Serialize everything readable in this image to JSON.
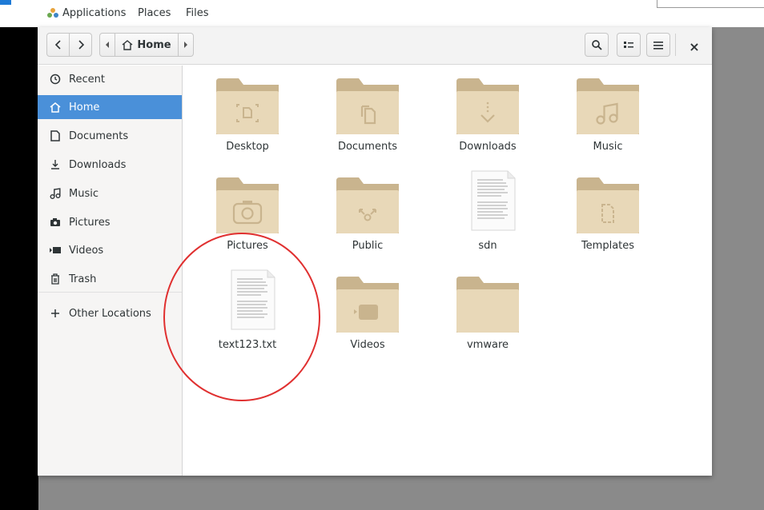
{
  "topbar": {
    "applications": "Applications",
    "places": "Places",
    "files": "Files"
  },
  "toolbar": {
    "back_icon": "chevron-left-icon",
    "forward_icon": "chevron-right-icon",
    "path_home": "Home",
    "search_icon": "search-icon",
    "view_icon": "view-toggle-icon",
    "menu_icon": "hamburger-icon",
    "close_glyph": "×"
  },
  "sidebar": {
    "items": [
      {
        "label": "Recent",
        "icon": "clock-icon",
        "active": false
      },
      {
        "label": "Home",
        "icon": "home-icon",
        "active": true
      },
      {
        "label": "Documents",
        "icon": "document-icon",
        "active": false
      },
      {
        "label": "Downloads",
        "icon": "download-icon",
        "active": false
      },
      {
        "label": "Music",
        "icon": "music-icon",
        "active": false
      },
      {
        "label": "Pictures",
        "icon": "camera-icon",
        "active": false
      },
      {
        "label": "Videos",
        "icon": "video-icon",
        "active": false
      },
      {
        "label": "Trash",
        "icon": "trash-icon",
        "active": false
      }
    ],
    "other_locations": "Other Locations"
  },
  "files": [
    {
      "name": "Desktop",
      "kind": "folder",
      "emblem": "desktop"
    },
    {
      "name": "Documents",
      "kind": "folder",
      "emblem": "documents"
    },
    {
      "name": "Downloads",
      "kind": "folder",
      "emblem": "downloads"
    },
    {
      "name": "Music",
      "kind": "folder",
      "emblem": "music"
    },
    {
      "name": "Pictures",
      "kind": "folder",
      "emblem": "pictures"
    },
    {
      "name": "Public",
      "kind": "folder",
      "emblem": "public"
    },
    {
      "name": "sdn",
      "kind": "text-file",
      "emblem": ""
    },
    {
      "name": "Templates",
      "kind": "folder",
      "emblem": "templates"
    },
    {
      "name": "text123.txt",
      "kind": "text-file",
      "emblem": ""
    },
    {
      "name": "Videos",
      "kind": "folder",
      "emblem": "videos"
    },
    {
      "name": "vmware",
      "kind": "folder",
      "emblem": ""
    }
  ],
  "colors": {
    "folder_body": "#e8d8b8",
    "folder_tab": "#c9b48e",
    "accent": "#4a90d9",
    "annotation": "#e03030"
  }
}
